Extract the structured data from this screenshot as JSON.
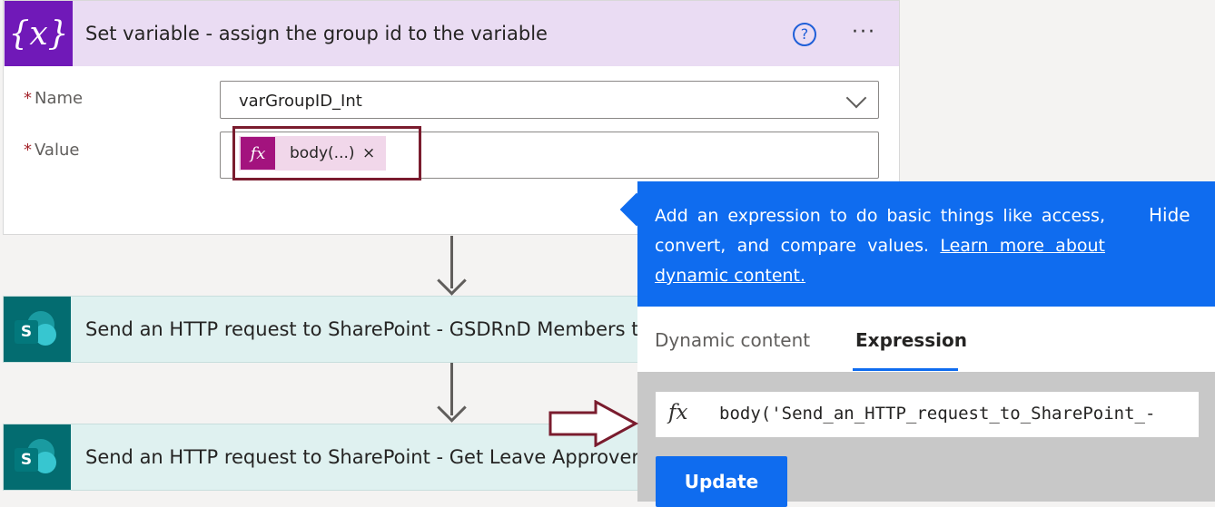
{
  "set_variable": {
    "icon_glyph": "{x}",
    "title": "Set variable - assign the group id to the variable",
    "help_glyph": "?",
    "more_glyph": "···",
    "name_label": "Name",
    "value_label": "Value",
    "required_mark": "*",
    "name_value": "varGroupID_Int",
    "token": {
      "fx": "fx",
      "label": "body(...)",
      "close": "×"
    }
  },
  "steps": [
    {
      "icon": "S",
      "title": "Send an HTTP request to SharePoint - GSDRnD Members to"
    },
    {
      "icon": "S",
      "title": "Send an HTTP request to SharePoint - Get Leave Approvers"
    }
  ],
  "panel": {
    "info_text": "Add an expression to do basic things like access, convert, and compare values.",
    "info_link": "Learn more about dynamic content.",
    "hide_label": "Hide",
    "tabs": [
      {
        "label": "Dynamic content",
        "active": false
      },
      {
        "label": "Expression",
        "active": true
      }
    ],
    "expression_fx": "fx",
    "expression_text": "body('Send_an_HTTP_request_to_SharePoint_-",
    "update_label": "Update"
  },
  "colors": {
    "variable_accent": "#7019b8",
    "token_accent": "#a3137e",
    "sharepoint_accent": "#036c70",
    "panel_blue": "#0f6cef",
    "annotation_red": "#7a1c2e"
  },
  "icons": [
    "variable-icon",
    "help-icon",
    "more-options-icon",
    "chevron-down-icon",
    "fx-icon",
    "close-icon",
    "sharepoint-icon",
    "annotation-arrow-icon"
  ]
}
